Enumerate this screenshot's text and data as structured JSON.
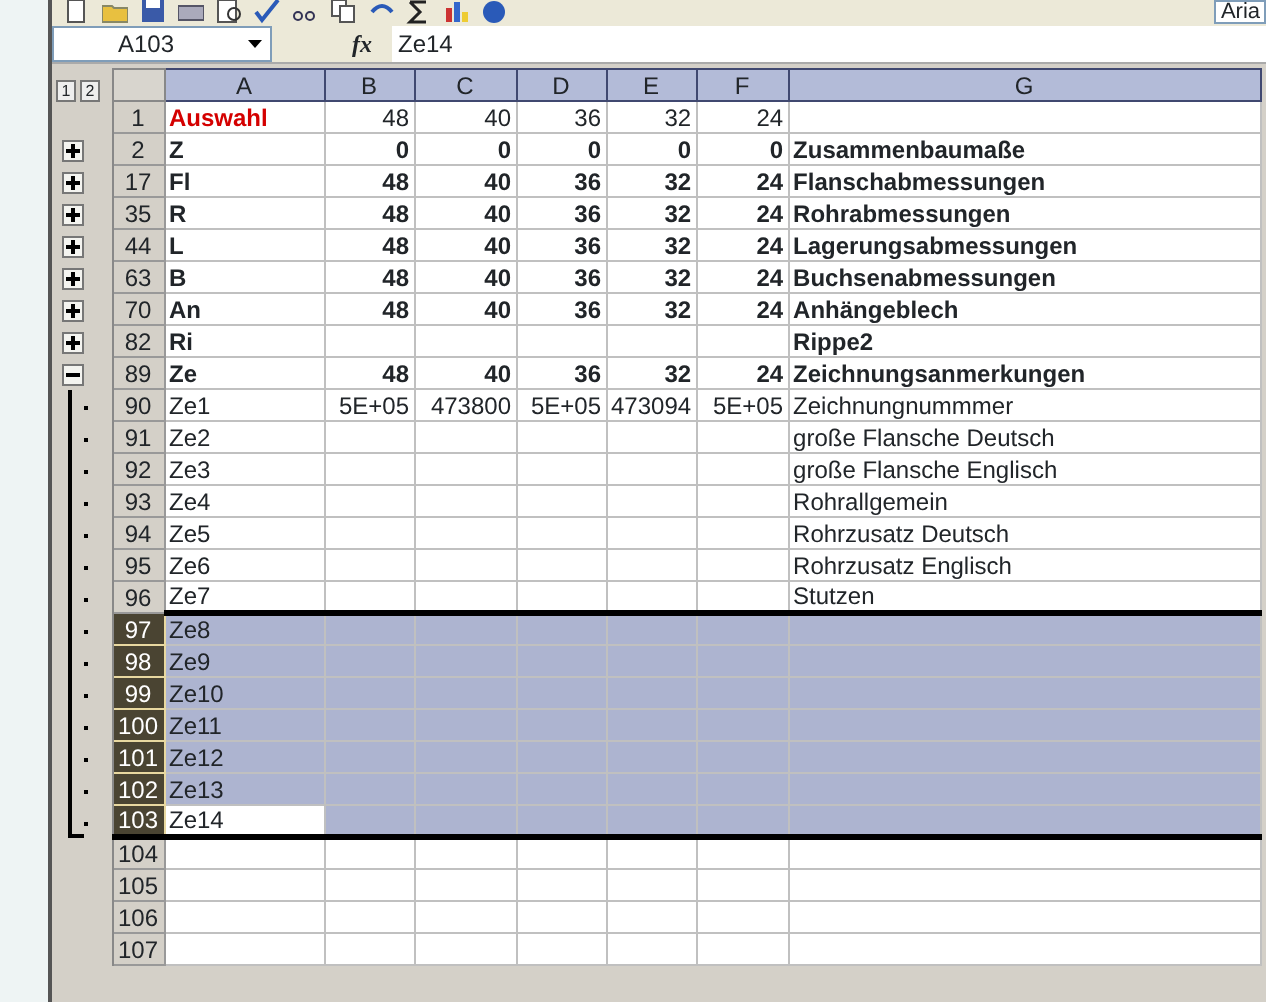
{
  "toolbar": {
    "font_box": "Aria"
  },
  "name_box": {
    "value": "A103"
  },
  "formula_bar": {
    "fx": "fx",
    "value": "Ze14"
  },
  "outline_levels": [
    "1",
    "2"
  ],
  "columns": [
    "A",
    "B",
    "C",
    "D",
    "E",
    "F",
    "G"
  ],
  "rows": [
    {
      "header": "1",
      "kind": "title",
      "selected": false,
      "active": false,
      "cells": [
        "Auswahl",
        "48",
        "40",
        "36",
        "32",
        "24",
        ""
      ]
    },
    {
      "header": "2",
      "kind": "group",
      "expanded": false,
      "selected": false,
      "active": false,
      "cells": [
        "Z",
        "0",
        "0",
        "0",
        "0",
        "0",
        "Zusammenbaumaße"
      ]
    },
    {
      "header": "17",
      "kind": "group",
      "expanded": false,
      "selected": false,
      "active": false,
      "cells": [
        "Fl",
        "48",
        "40",
        "36",
        "32",
        "24",
        "Flanschabmessungen"
      ]
    },
    {
      "header": "35",
      "kind": "group",
      "expanded": false,
      "selected": false,
      "active": false,
      "cells": [
        "R",
        "48",
        "40",
        "36",
        "32",
        "24",
        "Rohrabmessungen"
      ]
    },
    {
      "header": "44",
      "kind": "group",
      "expanded": false,
      "selected": false,
      "active": false,
      "cells": [
        "L",
        "48",
        "40",
        "36",
        "32",
        "24",
        "Lagerungsabmessungen"
      ]
    },
    {
      "header": "63",
      "kind": "group",
      "expanded": false,
      "selected": false,
      "active": false,
      "cells": [
        "B",
        "48",
        "40",
        "36",
        "32",
        "24",
        "Buchsenabmessungen"
      ]
    },
    {
      "header": "70",
      "kind": "group",
      "expanded": false,
      "selected": false,
      "active": false,
      "cells": [
        "An",
        "48",
        "40",
        "36",
        "32",
        "24",
        "Anhängeblech"
      ]
    },
    {
      "header": "82",
      "kind": "group",
      "expanded": false,
      "selected": false,
      "active": false,
      "cells": [
        "Ri",
        "",
        "",
        "",
        "",
        "",
        "Rippe2"
      ]
    },
    {
      "header": "89",
      "kind": "group",
      "expanded": true,
      "selected": false,
      "active": false,
      "cells": [
        "Ze",
        "48",
        "40",
        "36",
        "32",
        "24",
        "Zeichnungsanmerkungen"
      ]
    },
    {
      "header": "90",
      "kind": "detail",
      "selected": false,
      "active": false,
      "cells": [
        "Ze1",
        "5E+05",
        "473800",
        "5E+05",
        "473094",
        "5E+05",
        "Zeichnungnummmer"
      ]
    },
    {
      "header": "91",
      "kind": "detail",
      "selected": false,
      "active": false,
      "cells": [
        "Ze2",
        "",
        "",
        "",
        "",
        "",
        "große Flansche Deutsch"
      ]
    },
    {
      "header": "92",
      "kind": "detail",
      "selected": false,
      "active": false,
      "cells": [
        "Ze3",
        "",
        "",
        "",
        "",
        "",
        "große Flansche Englisch"
      ]
    },
    {
      "header": "93",
      "kind": "detail",
      "selected": false,
      "active": false,
      "cells": [
        "Ze4",
        "",
        "",
        "",
        "",
        "",
        "Rohrallgemein"
      ]
    },
    {
      "header": "94",
      "kind": "detail",
      "selected": false,
      "active": false,
      "cells": [
        "Ze5",
        "",
        "",
        "",
        "",
        "",
        "Rohrzusatz Deutsch"
      ]
    },
    {
      "header": "95",
      "kind": "detail",
      "selected": false,
      "active": false,
      "cells": [
        "Ze6",
        "",
        "",
        "",
        "",
        "",
        "Rohrzusatz Englisch"
      ]
    },
    {
      "header": "96",
      "kind": "detail",
      "selected": false,
      "active": false,
      "cells": [
        "Ze7",
        "",
        "",
        "",
        "",
        "",
        "Stutzen"
      ]
    },
    {
      "header": "97",
      "kind": "detail",
      "selected": true,
      "active": false,
      "cells": [
        "Ze8",
        "",
        "",
        "",
        "",
        "",
        ""
      ]
    },
    {
      "header": "98",
      "kind": "detail",
      "selected": true,
      "active": false,
      "cells": [
        "Ze9",
        "",
        "",
        "",
        "",
        "",
        ""
      ]
    },
    {
      "header": "99",
      "kind": "detail",
      "selected": true,
      "active": false,
      "cells": [
        "Ze10",
        "",
        "",
        "",
        "",
        "",
        ""
      ]
    },
    {
      "header": "100",
      "kind": "detail",
      "selected": true,
      "active": false,
      "cells": [
        "Ze11",
        "",
        "",
        "",
        "",
        "",
        ""
      ]
    },
    {
      "header": "101",
      "kind": "detail",
      "selected": true,
      "active": false,
      "cells": [
        "Ze12",
        "",
        "",
        "",
        "",
        "",
        ""
      ]
    },
    {
      "header": "102",
      "kind": "detail",
      "selected": true,
      "active": false,
      "cells": [
        "Ze13",
        "",
        "",
        "",
        "",
        "",
        ""
      ]
    },
    {
      "header": "103",
      "kind": "detail",
      "selected": true,
      "active": true,
      "cells": [
        "Ze14",
        "",
        "",
        "",
        "",
        "",
        ""
      ]
    },
    {
      "header": "104",
      "kind": "empty",
      "selected": false,
      "active": false,
      "cells": [
        "",
        "",
        "",
        "",
        "",
        "",
        ""
      ]
    },
    {
      "header": "105",
      "kind": "empty",
      "selected": false,
      "active": false,
      "cells": [
        "",
        "",
        "",
        "",
        "",
        "",
        ""
      ]
    },
    {
      "header": "106",
      "kind": "empty",
      "selected": false,
      "active": false,
      "cells": [
        "",
        "",
        "",
        "",
        "",
        "",
        ""
      ]
    },
    {
      "header": "107",
      "kind": "empty",
      "selected": false,
      "active": false,
      "cells": [
        "",
        "",
        "",
        "",
        "",
        "",
        ""
      ]
    }
  ]
}
